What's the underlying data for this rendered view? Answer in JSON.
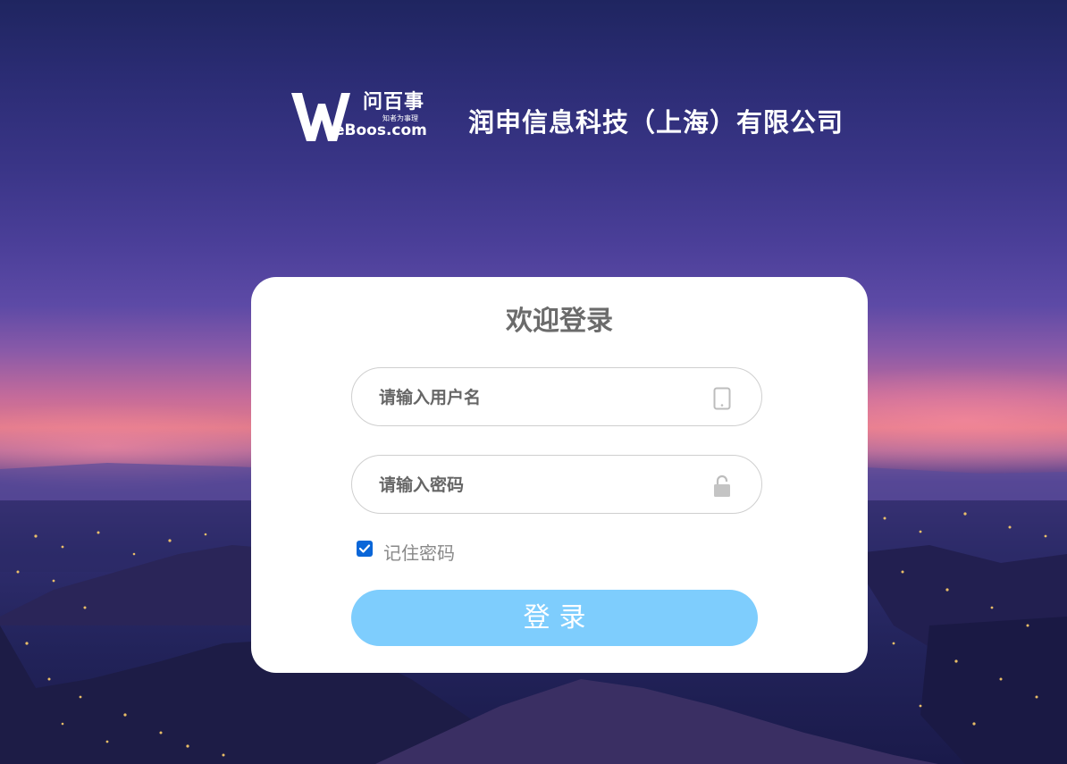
{
  "brand": {
    "logo_cn": "问百事",
    "logo_en": "eBoos.com",
    "logo_tagline": "知者为事理",
    "company_name": "润申信息科技（上海）有限公司"
  },
  "login": {
    "title": "欢迎登录",
    "username_placeholder": "请输入用户名",
    "password_placeholder": "请输入密码",
    "remember_label": "记住密码",
    "remember_checked": true,
    "submit_label": "登录"
  },
  "icons": {
    "username_icon": "tablet-icon",
    "password_icon": "unlock-icon",
    "check_icon": "checkmark-icon"
  },
  "colors": {
    "button_bg": "#7ecdfd",
    "checkbox": "#0a66d8",
    "title_text": "#6b6b6b",
    "field_border": "#cfcfcf"
  }
}
